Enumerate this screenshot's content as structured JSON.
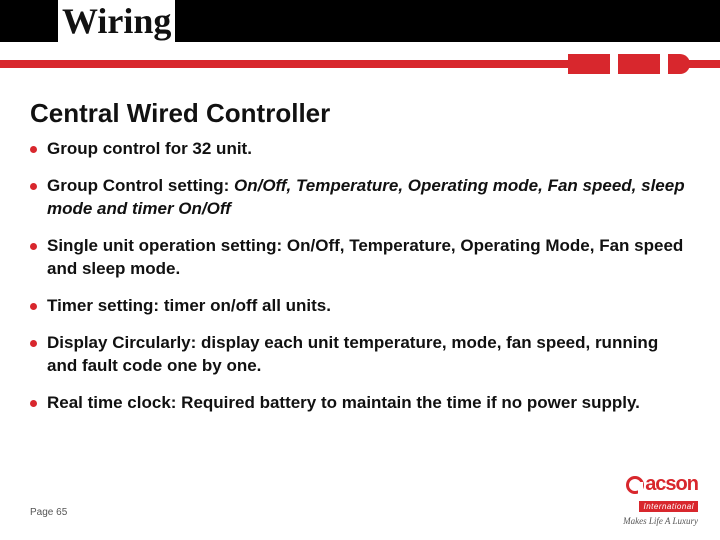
{
  "title": "Wiring",
  "subtitle": "Central Wired Controller",
  "bullets": [
    {
      "bold": "Group control for 32 unit.",
      "italic": ""
    },
    {
      "bold": "Group Control setting: ",
      "italic": "On/Off, Temperature, Operating mode, Fan speed, sleep mode and timer On/Off"
    },
    {
      "bold": "Single unit operation setting: On/Off, Temperature, Operating Mode, Fan speed and sleep mode.",
      "italic": ""
    },
    {
      "bold": "Timer setting: timer on/off all units.",
      "italic": ""
    },
    {
      "bold": "Display Circularly: display each unit temperature, mode, fan speed, running and fault code one by one.",
      "italic": ""
    },
    {
      "bold": "Real time clock: Required battery to maintain the time if no power supply.",
      "italic": ""
    }
  ],
  "page_label": "Page 65",
  "logo": {
    "brand": "acson",
    "intl": "International",
    "tagline": "Makes Life A Luxury"
  },
  "colors": {
    "accent": "#d8272d",
    "black": "#000000"
  }
}
